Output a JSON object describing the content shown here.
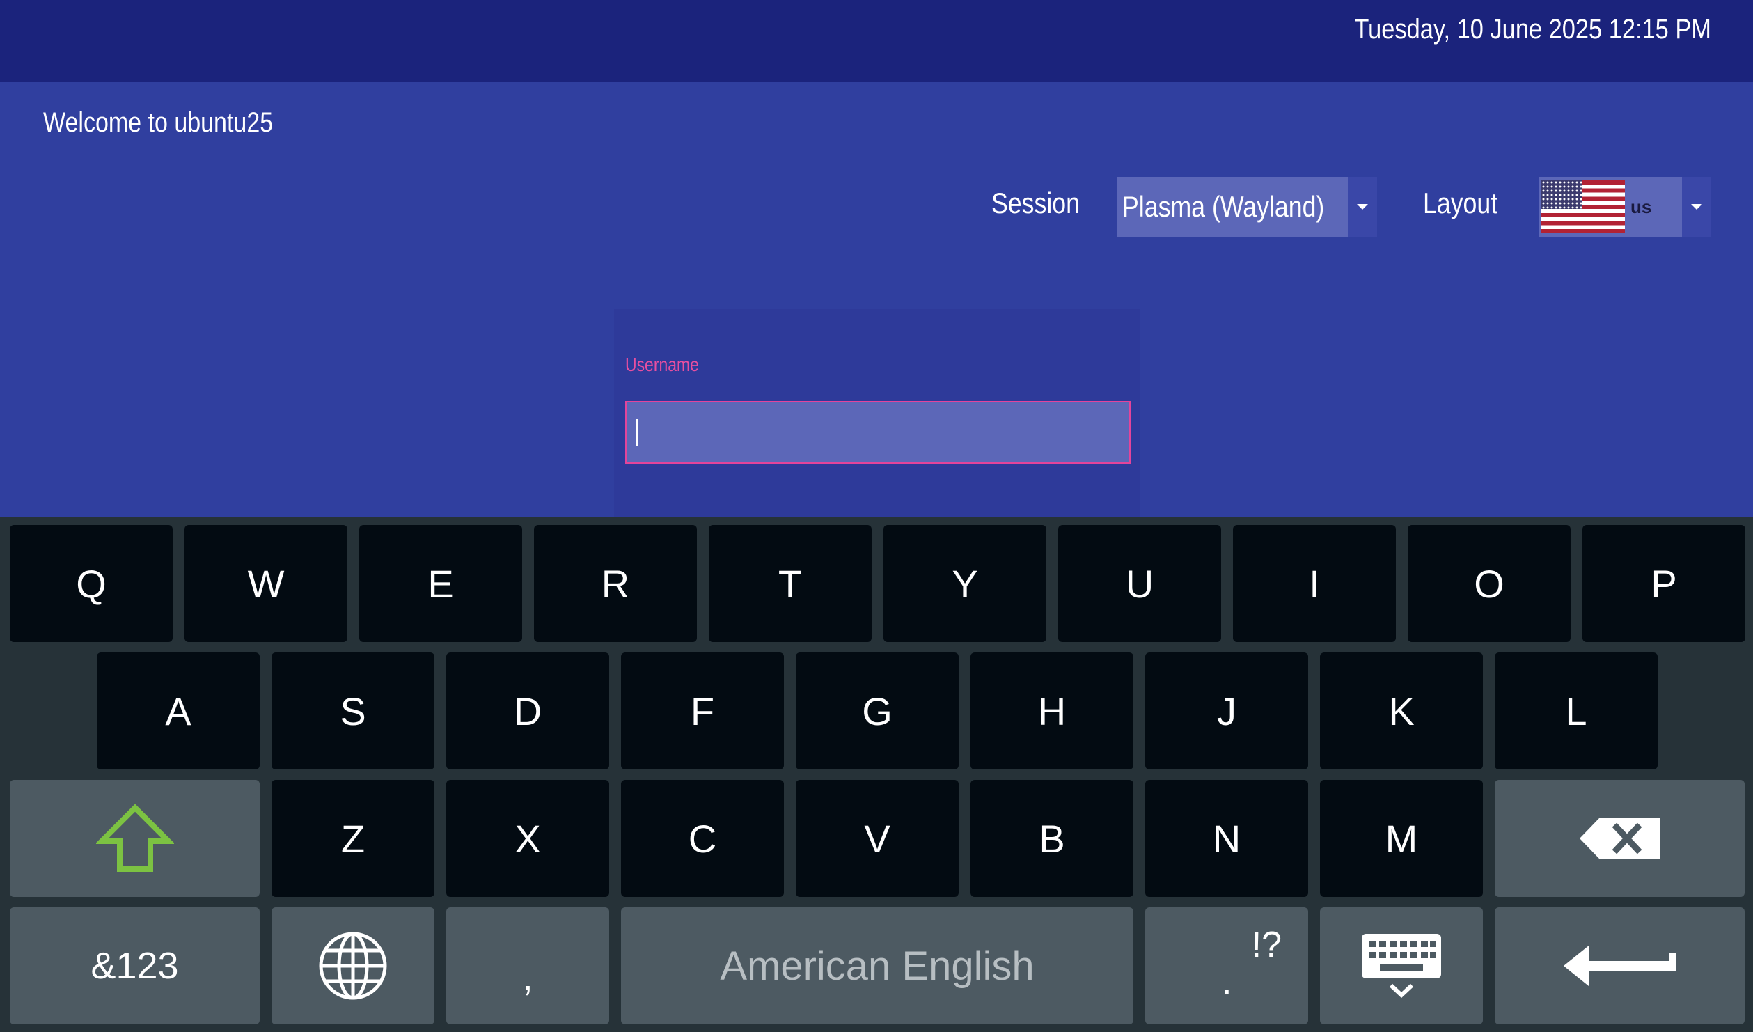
{
  "topbar": {
    "datetime": "Tuesday, 10 June 2025  12:15 PM"
  },
  "main": {
    "welcome": "Welcome to ubuntu25",
    "session": {
      "label": "Session",
      "value": "Plasma (Wayland)"
    },
    "layout": {
      "label": "Layout",
      "flag_icon": "us-flag-icon",
      "code": "us"
    },
    "login": {
      "username_label": "Username",
      "username_value": ""
    }
  },
  "keyboard": {
    "row1": [
      "Q",
      "W",
      "E",
      "R",
      "T",
      "Y",
      "U",
      "I",
      "O",
      "P"
    ],
    "row2": [
      "A",
      "S",
      "D",
      "F",
      "G",
      "H",
      "J",
      "K",
      "L"
    ],
    "row3": [
      "Z",
      "X",
      "C",
      "V",
      "B",
      "N",
      "M"
    ],
    "row4": {
      "symbols": "&123",
      "comma": ",",
      "space": "American English",
      "period": ".",
      "period_alt": "!?"
    },
    "icons": {
      "shift": "shift-arrow-icon",
      "backspace": "backspace-icon",
      "language": "globe-icon",
      "hide": "keyboard-hide-icon",
      "enter": "enter-arrow-icon"
    },
    "colors": {
      "shift_accent": "#7cc242",
      "key_bg": "#030b12",
      "fn_key_bg": "#4d5a62",
      "keyboard_bg": "#263238"
    }
  },
  "colors": {
    "topbar_bg": "#1b237c",
    "main_bg": "#303f9f",
    "field_bg": "#5c67b8",
    "focus_border": "#e3449b"
  }
}
